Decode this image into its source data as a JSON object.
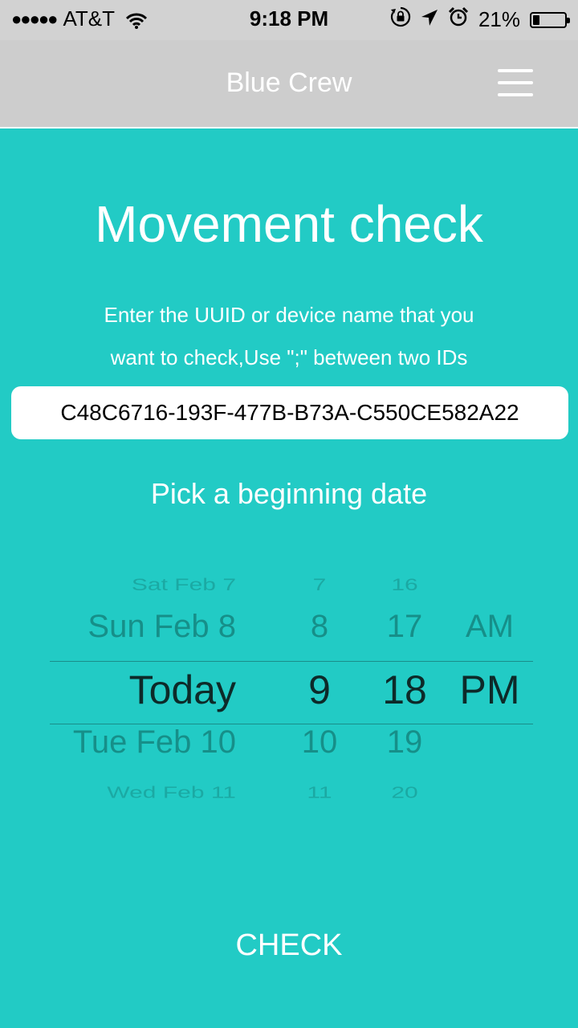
{
  "status_bar": {
    "signal_dots": "●●●●●",
    "carrier": "AT&T",
    "time": "9:18 PM",
    "battery_percent_text": "21%",
    "battery_level": 0.21
  },
  "nav": {
    "title": "Blue Crew"
  },
  "main": {
    "title": "Movement check",
    "instruction_line1": "Enter the UUID or device name that you",
    "instruction_line2": "want to check,Use \";\" between two IDs",
    "uuid_value": "C48C6716-193F-477B-B73A-C550CE582A22",
    "date_label": "Pick a beginning date",
    "check_button": "CHECK"
  },
  "picker": {
    "rows": [
      {
        "date": "Sat Feb 7",
        "hour": "7",
        "minute": "16",
        "ampm": ""
      },
      {
        "date": "Sun Feb 8",
        "hour": "8",
        "minute": "17",
        "ampm": "AM"
      },
      {
        "date": "Today",
        "hour": "9",
        "minute": "18",
        "ampm": "PM"
      },
      {
        "date": "Tue Feb 10",
        "hour": "10",
        "minute": "19",
        "ampm": ""
      },
      {
        "date": "Wed Feb 11",
        "hour": "11",
        "minute": "20",
        "ampm": ""
      }
    ],
    "selected_index": 2
  },
  "colors": {
    "background": "#22cbc5",
    "navbar": "#cdcdcd",
    "picker_selected": "#0d2a29",
    "picker_unselected": "#168f89"
  }
}
